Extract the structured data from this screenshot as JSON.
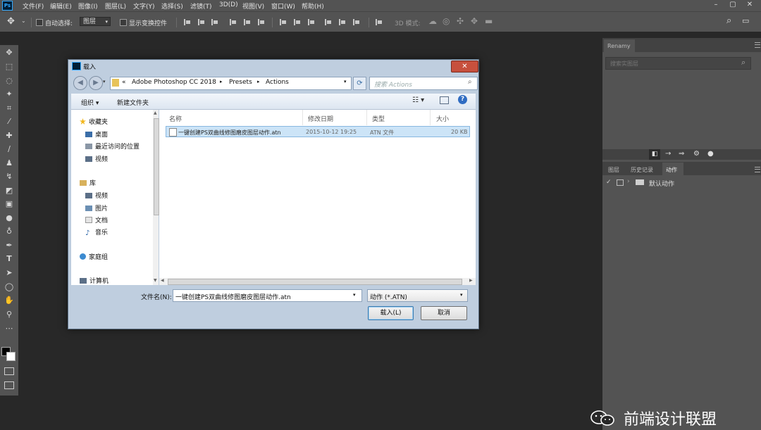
{
  "menubar": {
    "logo": "Ps",
    "items": [
      "文件(F)",
      "编辑(E)",
      "图像(I)",
      "图层(L)",
      "文字(Y)",
      "选择(S)",
      "滤镜(T)",
      "3D(D)",
      "视图(V)",
      "窗口(W)",
      "帮助(H)"
    ],
    "window_buttons": [
      "–",
      "▢",
      "✕"
    ]
  },
  "options": {
    "auto_select_label": "自动选择:",
    "auto_select_value": "图层",
    "show_transform_label": "显示变换控件",
    "mode_3d_label": "3D 模式:"
  },
  "right_panel": {
    "tab_top": "Renamy",
    "search_placeholder": "搜索实图层",
    "tabs": [
      "图层",
      "历史记录",
      "动作"
    ],
    "action_set": "默认动作"
  },
  "dialog": {
    "title": "载入",
    "close": "✕",
    "breadcrumb_prefix": "«",
    "breadcrumb": [
      "Adobe Photoshop CC 2018",
      "Presets",
      "Actions"
    ],
    "search_placeholder": "搜索 Actions",
    "organize": "组织 ▾",
    "new_folder": "新建文件夹",
    "nav": {
      "favorites": "收藏夹",
      "desktop": "桌面",
      "recent": "最近访问的位置",
      "video_fav": "视频",
      "library": "库",
      "video": "视频",
      "pictures": "图片",
      "documents": "文档",
      "music": "音乐",
      "homegroup": "家庭组",
      "computer": "计算机"
    },
    "columns": {
      "name": "名称",
      "modified": "修改日期",
      "type": "类型",
      "size": "大小"
    },
    "files": [
      {
        "name": "一键创建PS双曲线修图磨皮图层动作.atn",
        "modified": "2015-10-12 19:25",
        "type": "ATN 文件",
        "size": "20 KB"
      }
    ],
    "filename_label": "文件名(N):",
    "filename_value": "一键创建PS双曲线修图磨皮图层动作.atn",
    "filetype_value": "动作 (*.ATN)",
    "load_button": "载入(L)",
    "cancel_button": "取消"
  },
  "watermark": "前端设计联盟"
}
